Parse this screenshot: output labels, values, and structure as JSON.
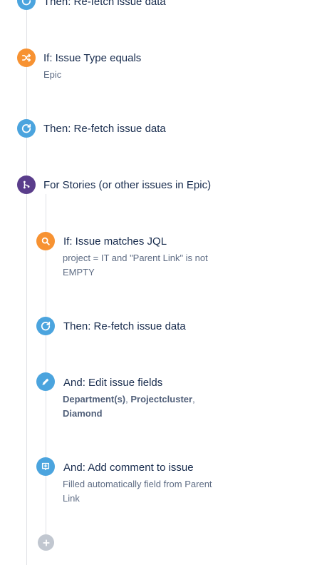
{
  "colors": {
    "condition": "#f79232",
    "action": "#4ba4de",
    "branch": "#5a3d8b",
    "add": "#c1c7d0",
    "line": "#dfe1e6"
  },
  "steps": [
    {
      "icon": "refresh-icon",
      "title": "Then: Re-fetch issue data"
    },
    {
      "icon": "shuffle-icon",
      "title": "If: Issue Type equals",
      "detail": "Epic"
    },
    {
      "icon": "refresh-icon",
      "title": "Then: Re-fetch issue data"
    },
    {
      "icon": "branch-icon",
      "title": "For Stories (or other issues in Epic)"
    },
    {
      "icon": "search-icon",
      "title": "If: Issue matches JQL",
      "detail_line1": "project = IT and \"Parent Link\" is not",
      "detail_line2": "EMPTY"
    },
    {
      "icon": "refresh-icon",
      "title": "Then: Re-fetch issue data"
    },
    {
      "icon": "pencil-icon",
      "title": "And: Edit issue fields",
      "fields": [
        "Department(s)",
        "Projectcluster",
        "Diamond"
      ],
      "separator": ", "
    },
    {
      "icon": "comment-icon",
      "title": "And: Add comment to issue",
      "detail_line1": "Filled automatically field from Parent",
      "detail_line2": "Link"
    }
  ],
  "add_button": {
    "icon": "plus-icon"
  }
}
